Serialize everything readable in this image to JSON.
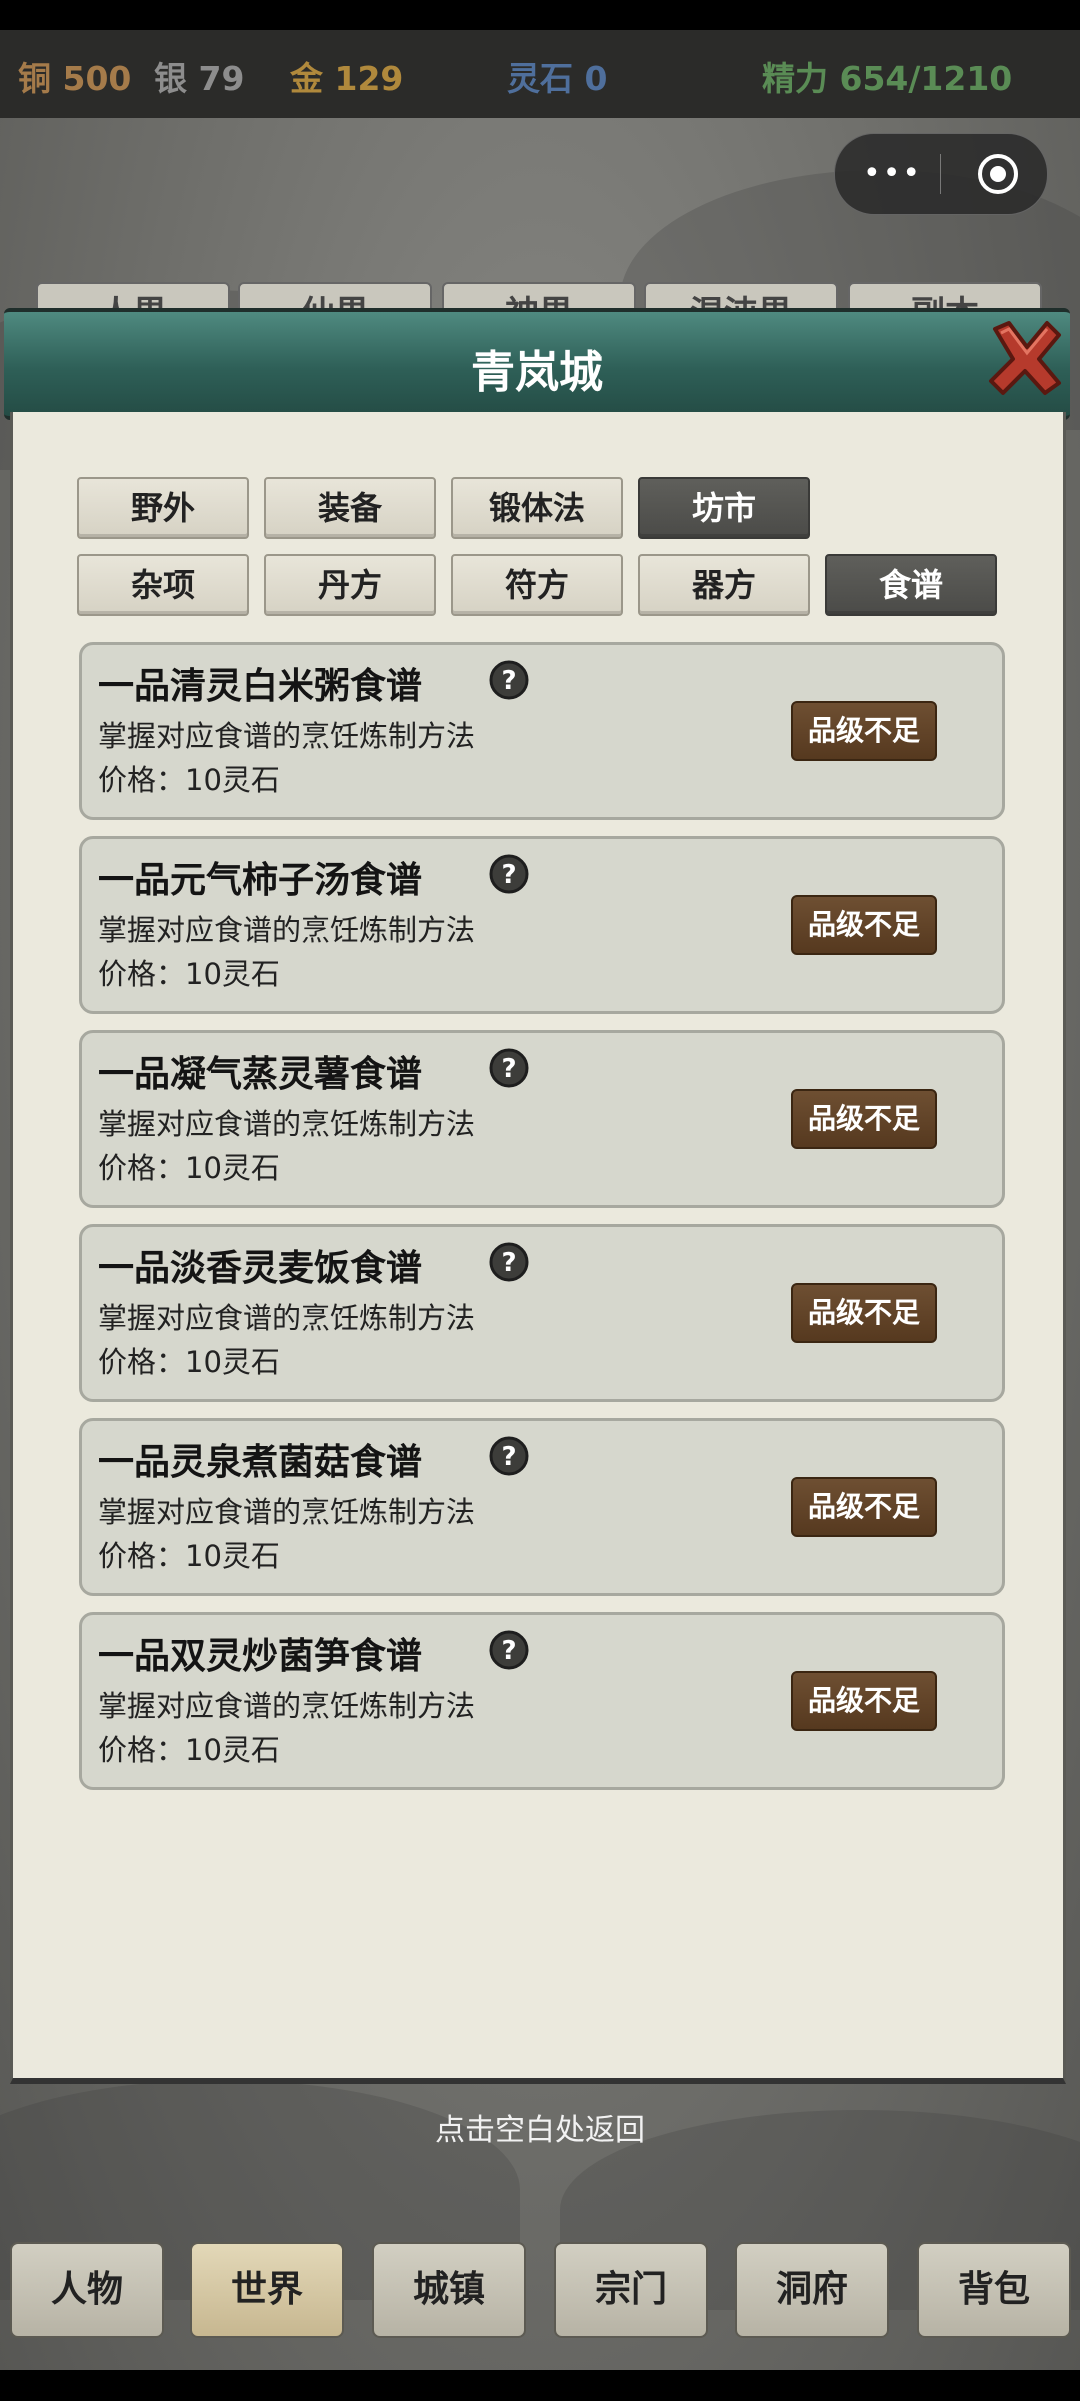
{
  "currency": {
    "copper": "铜 500",
    "silver": "银 79",
    "gold": "金 129",
    "spirit_stone": "灵石 0",
    "energy": "精力 654/1210",
    "colors": {
      "copper": "#a57b4a",
      "silver": "#8d8d8d",
      "gold": "#b0893c",
      "spirit_stone": "#4f6f9c",
      "energy": "#5a8c55"
    }
  },
  "capsule": {
    "more_icon": "more-dots-icon",
    "close_icon": "target-circle-icon"
  },
  "behind_tabs": [
    "人界",
    "仙界",
    "神界",
    "混沌界",
    "副本"
  ],
  "modal": {
    "title": "青岚城",
    "close_icon": "close-x-icon",
    "tabs_row1": [
      "野外",
      "装备",
      "锻体法",
      "坊市"
    ],
    "tabs_row2": [
      "杂项",
      "丹方",
      "符方",
      "器方",
      "食谱"
    ],
    "active_tabs": [
      "坊市",
      "食谱"
    ],
    "items": [
      {
        "title": "一品清灵白米粥食谱",
        "desc": "掌握对应食谱的烹饪炼制方法",
        "price": "价格：10灵石",
        "button": "品级不足"
      },
      {
        "title": "一品元气柿子汤食谱",
        "desc": "掌握对应食谱的烹饪炼制方法",
        "price": "价格：10灵石",
        "button": "品级不足"
      },
      {
        "title": "一品凝气蒸灵薯食谱",
        "desc": "掌握对应食谱的烹饪炼制方法",
        "price": "价格：10灵石",
        "button": "品级不足"
      },
      {
        "title": "一品淡香灵麦饭食谱",
        "desc": "掌握对应食谱的烹饪炼制方法",
        "price": "价格：10灵石",
        "button": "品级不足"
      },
      {
        "title": "一品灵泉煮菌菇食谱",
        "desc": "掌握对应食谱的烹饪炼制方法",
        "price": "价格：10灵石",
        "button": "品级不足"
      },
      {
        "title": "一品双灵炒菌笋食谱",
        "desc": "掌握对应食谱的烹饪炼制方法",
        "price": "价格：10灵石",
        "button": "品级不足"
      }
    ]
  },
  "return_hint": "点击空白处返回",
  "bottom_nav": [
    "人物",
    "世界",
    "城镇",
    "宗门",
    "洞府",
    "背包"
  ],
  "bottom_nav_active": "世界"
}
